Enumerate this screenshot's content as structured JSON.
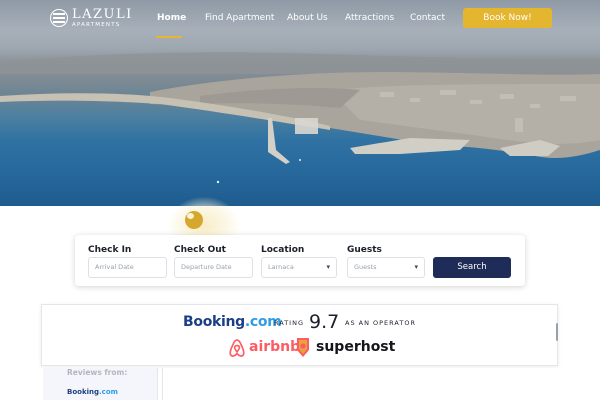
{
  "logo": {
    "name": "LAZULI",
    "subtitle": "APARTMENTS"
  },
  "nav": {
    "items": [
      "Home",
      "Find Apartment",
      "About Us",
      "Attractions",
      "Contact"
    ],
    "active": "Home",
    "book_label": "Book Now!"
  },
  "search": {
    "checkin_label": "Check In",
    "checkin_placeholder": "Arrival Date",
    "checkout_label": "Check Out",
    "checkout_placeholder": "Departure Date",
    "location_label": "Location",
    "location_value": "Larnaca",
    "guests_label": "Guests",
    "guests_value": "Guests",
    "button_label": "Search"
  },
  "rating": {
    "booking_brand": "Booking",
    "booking_suffix": ".com",
    "rating_word": "RATING",
    "score": "9.7",
    "operator_text": "AS AN OPERATOR",
    "airbnb_label": "airbnb",
    "superhost_label": "superhost"
  },
  "reviews": {
    "title": "Reviews from:",
    "source_brand": "Booking",
    "source_suffix": ".com"
  },
  "colors": {
    "accent": "#e4b52f",
    "search_button": "#1f2c57",
    "booking_blue": "#1b3f86",
    "airbnb": "#fd5c63"
  }
}
